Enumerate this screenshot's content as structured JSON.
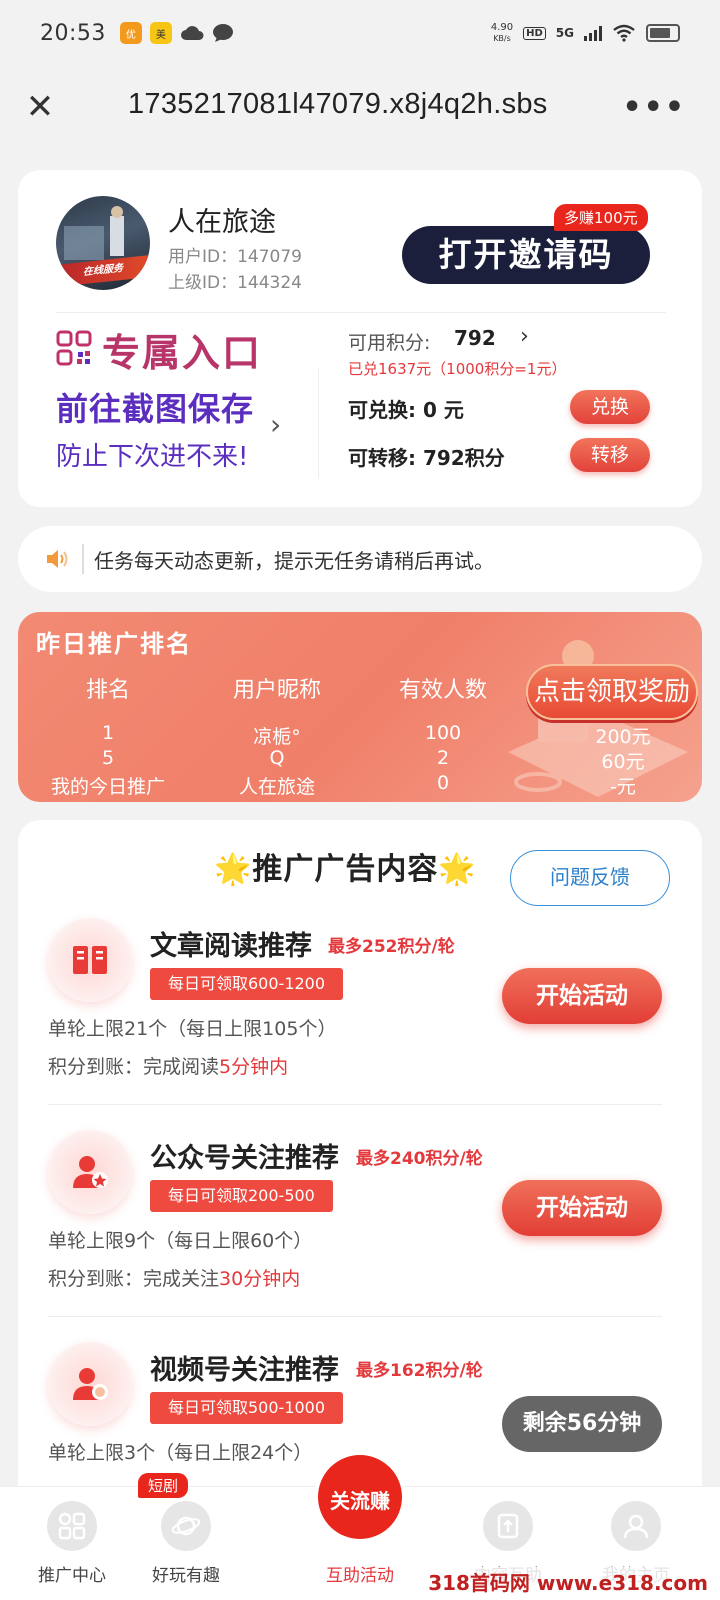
{
  "status_bar": {
    "time": "20:53",
    "net_speed_value": "4.90",
    "net_speed_unit": "KB/s",
    "hd": "HD",
    "network": "5G"
  },
  "browser": {
    "url": "1735217081l47079.x8j4q2h.sbs",
    "close_icon": "close-icon",
    "more_icon": "more-icon"
  },
  "user": {
    "name": "人在旅途",
    "user_id": "用户ID：147079",
    "parent_id": "上级ID：144324",
    "avatar_caption": "在线服务"
  },
  "invite": {
    "label": "打开邀请码",
    "badge": "多赚100元"
  },
  "entry": {
    "title": "专属入口",
    "subtitle": "前往截图保存",
    "hint": "防止下次进不来!"
  },
  "points": {
    "available_label": "可用积分:",
    "available_value": "792",
    "redeemed_note": "已兑1637元（1000积分=1元）",
    "exchangeable": "可兑换: 0 元",
    "exchange_btn": "兑换",
    "transferable": "可转移: 792积分",
    "transfer_btn": "转移"
  },
  "notice": {
    "text": "任务每天动态更新，提示无任务请稍后再试。"
  },
  "ranking": {
    "title": "昨日推广排名",
    "headers": [
      "排名",
      "用户昵称",
      "有效人数"
    ],
    "claim_btn": "点击领取奖励",
    "rows": [
      {
        "rank": "1",
        "nick": "凉栀°",
        "count": "100",
        "reward": "200元"
      },
      {
        "rank": "5",
        "nick": "Q",
        "count": "2",
        "reward": "60元"
      },
      {
        "rank": "我的今日推广",
        "nick": "人在旅途",
        "count": "0",
        "reward": "-元"
      }
    ]
  },
  "ads": {
    "star": "🌟",
    "title": "推广广告内容",
    "feedback_btn": "问题反馈",
    "tasks": [
      {
        "name": "文章阅读推荐",
        "max": "最多252积分/轮",
        "daily": "每日可领取600-1200",
        "limit": "单轮上限21个（每日上限105个）",
        "arrive_prefix": "积分到账：完成阅读",
        "arrive_time": "5分钟内",
        "button": "开始活动"
      },
      {
        "name": "公众号关注推荐",
        "max": "最多240积分/轮",
        "daily": "每日可领取200-500",
        "limit": "单轮上限9个（每日上限60个）",
        "arrive_prefix": "积分到账：完成关注",
        "arrive_time": "30分钟内",
        "button": "开始活动"
      },
      {
        "name": "视频号关注推荐",
        "max": "最多162积分/轮",
        "daily": "每日可领取500-1000",
        "limit": "单轮上限3个（每日上限24个）",
        "button": "剩余56分钟"
      }
    ]
  },
  "bottom_nav": {
    "items": [
      "推广中心",
      "好玩有趣",
      "互助活动",
      "内容互助",
      "我的主页"
    ],
    "tag": "短剧",
    "center_label": "关流赚"
  },
  "watermark": "318首码网 www.e318.com",
  "colors": {
    "accent_red": "#e4393c",
    "invite_dark": "#1b1f3b",
    "purple": "#5b2ec0",
    "ranking_bg": "#f07f69"
  }
}
